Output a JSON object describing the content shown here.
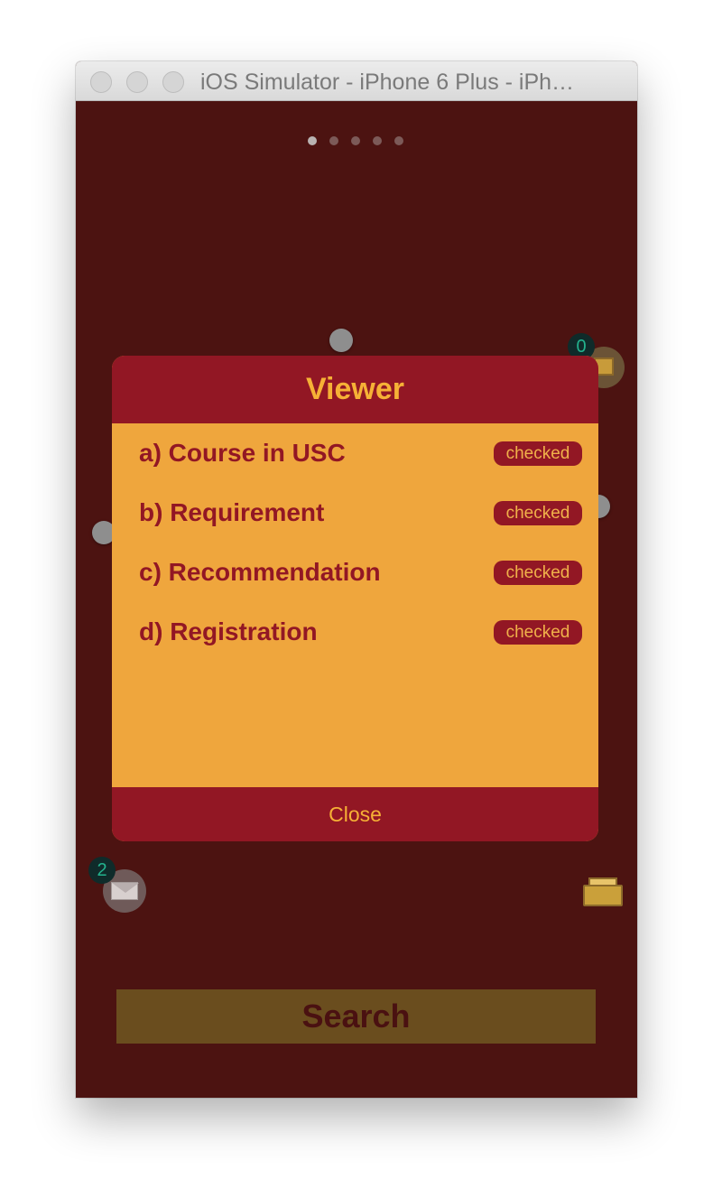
{
  "window": {
    "title": "iOS Simulator - iPhone 6 Plus - iPh…"
  },
  "page_indicator": {
    "count": 5,
    "active_index": 0
  },
  "badges": {
    "top_right_count": "0",
    "bottom_left_count": "2"
  },
  "icons": {
    "box": "box-icon",
    "mail": "mail-icon",
    "tray": "inbox-tray-icon"
  },
  "modal": {
    "title": "Viewer",
    "items": [
      {
        "label": "a) Course in USC",
        "status": "checked"
      },
      {
        "label": "b) Requirement",
        "status": "checked"
      },
      {
        "label": "c) Recommendation",
        "status": "checked"
      },
      {
        "label": "d) Registration",
        "status": "checked"
      }
    ],
    "close_label": "Close"
  },
  "search": {
    "label": "Search"
  },
  "colors": {
    "background": "#4c1311",
    "modal_header": "#921724",
    "modal_body": "#efa63d",
    "accent_text": "#f6b136",
    "search_button": "#6a4d1e"
  }
}
